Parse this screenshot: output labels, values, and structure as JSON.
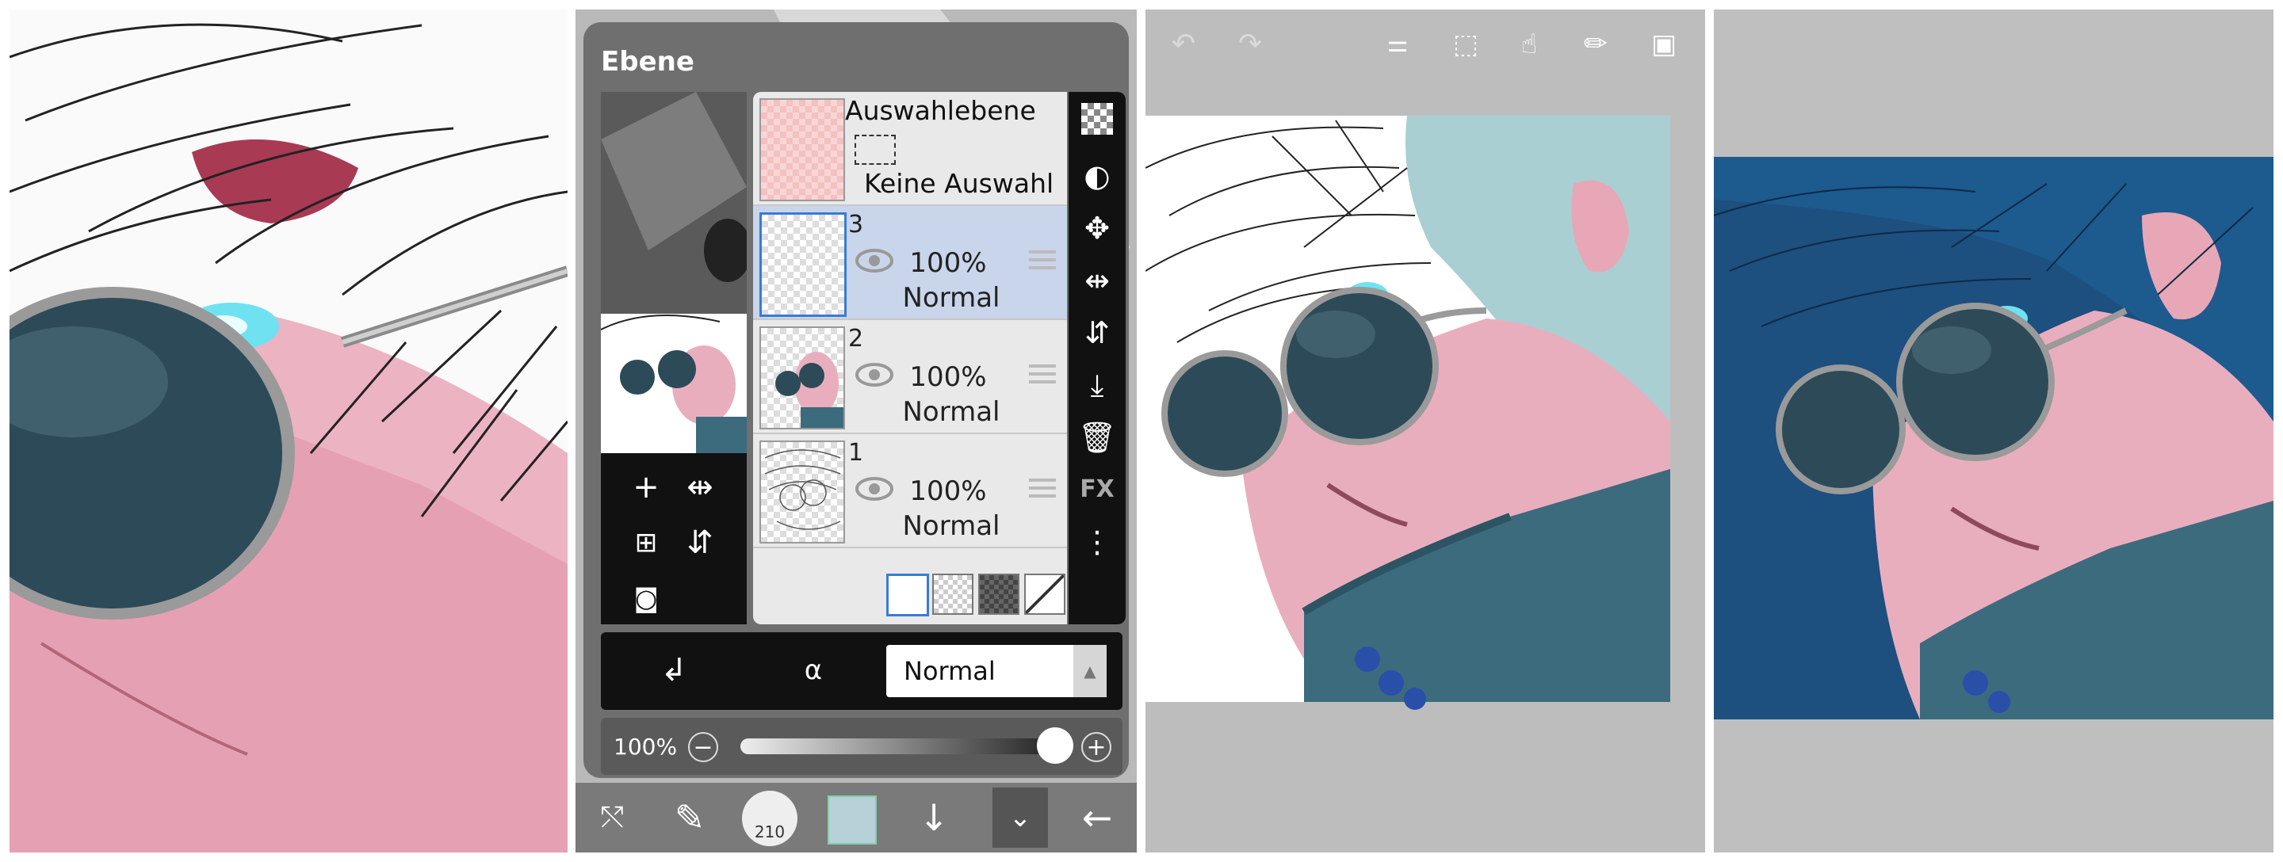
{
  "layers_panel": {
    "title": "Ebene",
    "selection_layer": {
      "name": "Auswahlebene",
      "status": "Keine Auswahl"
    },
    "layers": [
      {
        "number": "3",
        "opacity": "100%",
        "blend": "Normal",
        "selected": true
      },
      {
        "number": "2",
        "opacity": "100%",
        "blend": "Normal",
        "selected": false
      },
      {
        "number": "1",
        "opacity": "100%",
        "blend": "Normal",
        "selected": false
      }
    ],
    "blend_mode_select": "Normal",
    "opacity_slider": {
      "label": "100%",
      "value": 1.0
    },
    "right_tools": [
      "checker-icon",
      "half-circle-icon",
      "move-arrows-icon",
      "flip-horizontal-icon",
      "flip-vertical-icon",
      "merge-down-icon",
      "trash-icon",
      "fx",
      "more-vertical-icon"
    ],
    "fx_label": "FX"
  },
  "bottom_toolbar": {
    "brush_size": "210"
  },
  "colors": {
    "skin": "#e9aebe",
    "hair_light": "#a9cfd2",
    "coat": "#3c6b7e",
    "background_blue": "#1d4f7f",
    "selected_layer": "#c9d5ea",
    "dialog_grey": "#6f6f6f"
  }
}
